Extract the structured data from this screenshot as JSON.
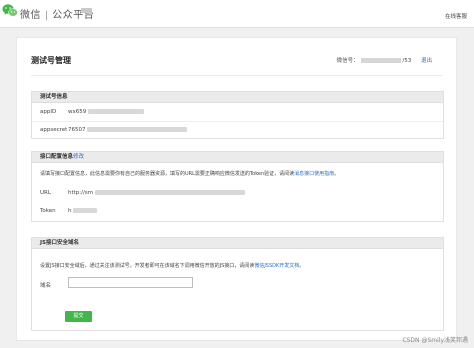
{
  "header": {
    "brand_name": "微信",
    "separator": "|",
    "platform_name": "公众平台",
    "help_link": "在线客服"
  },
  "page": {
    "title": "测试号管理",
    "account_label": "微信号：",
    "account_suffix": "/53",
    "logout_link": "退出"
  },
  "section_info": {
    "heading": "测试号信息",
    "rows": [
      {
        "label": "appID",
        "value_prefix": "wx659"
      },
      {
        "label": "appsecret",
        "value_prefix": "76507"
      }
    ]
  },
  "section_interface": {
    "heading": "接口配置信息",
    "edit_link": "修改",
    "description": "请填写接口配置信息，此信息需要你有自己的服务器资源，填写的URL需要正确响应微信发送的Token验证，请阅读",
    "description_link": "消息接口使用指南",
    "description_end": "。",
    "rows": [
      {
        "label": "URL",
        "value_prefix": "http://sm"
      },
      {
        "label": "Token",
        "value_prefix": "h"
      }
    ]
  },
  "section_js": {
    "heading": "JS接口安全域名",
    "description": "设置JS接口安全域后，通过关注该测试号，开发者即可在该域名下调用微信开放的JS接口，请阅读",
    "description_link": "微信JSSDK开发文档",
    "description_end": "。",
    "domain_label": "域名",
    "domain_value": "",
    "submit_label": "提交"
  },
  "watermark": "CSDN @Smily浅笑邦遇",
  "colors": {
    "accent_green": "#44b549",
    "link_blue": "#2b6fc8",
    "section_header_bg": "#ebebeb"
  },
  "icons": {
    "logo": "wechat-logo-icon"
  }
}
